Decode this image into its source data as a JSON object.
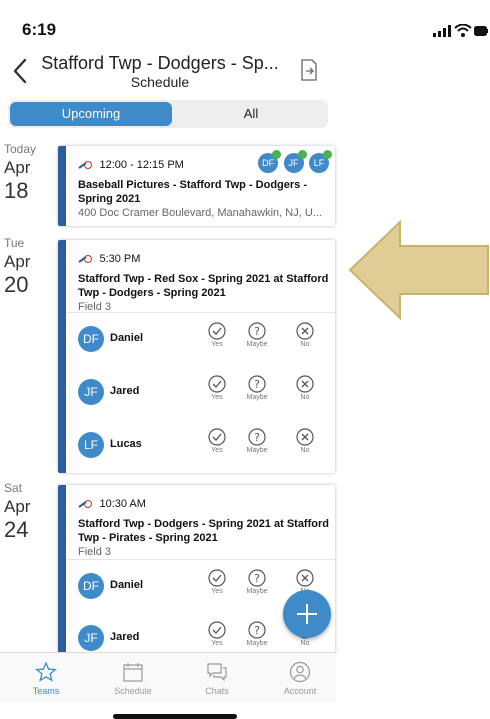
{
  "status": {
    "time": "6:19"
  },
  "header": {
    "title": "Stafford Twp - Dodgers - Sp...",
    "subtitle": "Schedule"
  },
  "segmented": {
    "upcoming": "Upcoming",
    "all": "All",
    "selected": "Upcoming"
  },
  "events": [
    {
      "dow": "Today",
      "month": "Apr",
      "day": "18",
      "time": "12:00 - 12:15 PM",
      "title": "Baseball Pictures - Stafford Twp - Dodgers - Spring 2021",
      "location": "400 Doc Cramer Boulevard, Manahawkin, NJ, U...",
      "avatars": [
        "DF",
        "JF",
        "LF"
      ]
    },
    {
      "dow": "Tue",
      "month": "Apr",
      "day": "20",
      "time": "5:30 PM",
      "title": "Stafford Twp - Red Sox - Spring 2021 at Stafford Twp - Dodgers - Spring 2021",
      "location": "Field 3",
      "rsvps": [
        {
          "initials": "DF",
          "name": "Daniel"
        },
        {
          "initials": "JF",
          "name": "Jared"
        },
        {
          "initials": "LF",
          "name": "Lucas"
        }
      ]
    },
    {
      "dow": "Sat",
      "month": "Apr",
      "day": "24",
      "time": "10:30 AM",
      "title": "Stafford Twp - Dodgers - Spring 2021 at Stafford Twp - Pirates - Spring 2021",
      "location": "Field 3",
      "rsvps": [
        {
          "initials": "DF",
          "name": "Daniel"
        },
        {
          "initials": "JF",
          "name": "Jared"
        }
      ]
    }
  ],
  "rsvp_options": {
    "yes": "Yes",
    "maybe": "Maybe",
    "no": "No"
  },
  "tabs": [
    {
      "label": "Teams",
      "icon": "star-icon",
      "active": true
    },
    {
      "label": "Schedule",
      "icon": "calendar-icon",
      "active": false
    },
    {
      "label": "Chats",
      "icon": "chat-icon",
      "active": false
    },
    {
      "label": "Account",
      "icon": "person-icon",
      "active": false
    }
  ],
  "colors": {
    "accent": "#3f8ac8",
    "card_bar": "#2e5d9e",
    "arrow_fill": "#e0cd96",
    "arrow_stroke": "#c8b36b"
  }
}
